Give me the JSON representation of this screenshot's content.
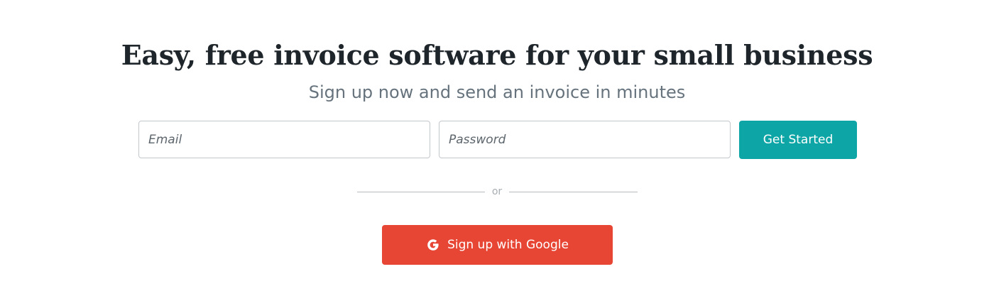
{
  "hero": {
    "title": "Easy, free invoice software for your small business",
    "subtitle": "Sign up now and send an invoice in minutes"
  },
  "signup_form": {
    "email": {
      "value": "",
      "placeholder": "Email"
    },
    "password": {
      "value": "",
      "placeholder": "Password"
    },
    "submit_label": "Get Started"
  },
  "divider": {
    "text": "or"
  },
  "google_signup": {
    "label": "Sign up with Google",
    "icon": "google-g-icon"
  },
  "colors": {
    "title": "#1f262b",
    "subtitle": "#66737d",
    "primary_button": "#0da5a5",
    "google_button": "#e84635",
    "input_border": "#c2c7cc",
    "divider": "#b7bcc0"
  }
}
